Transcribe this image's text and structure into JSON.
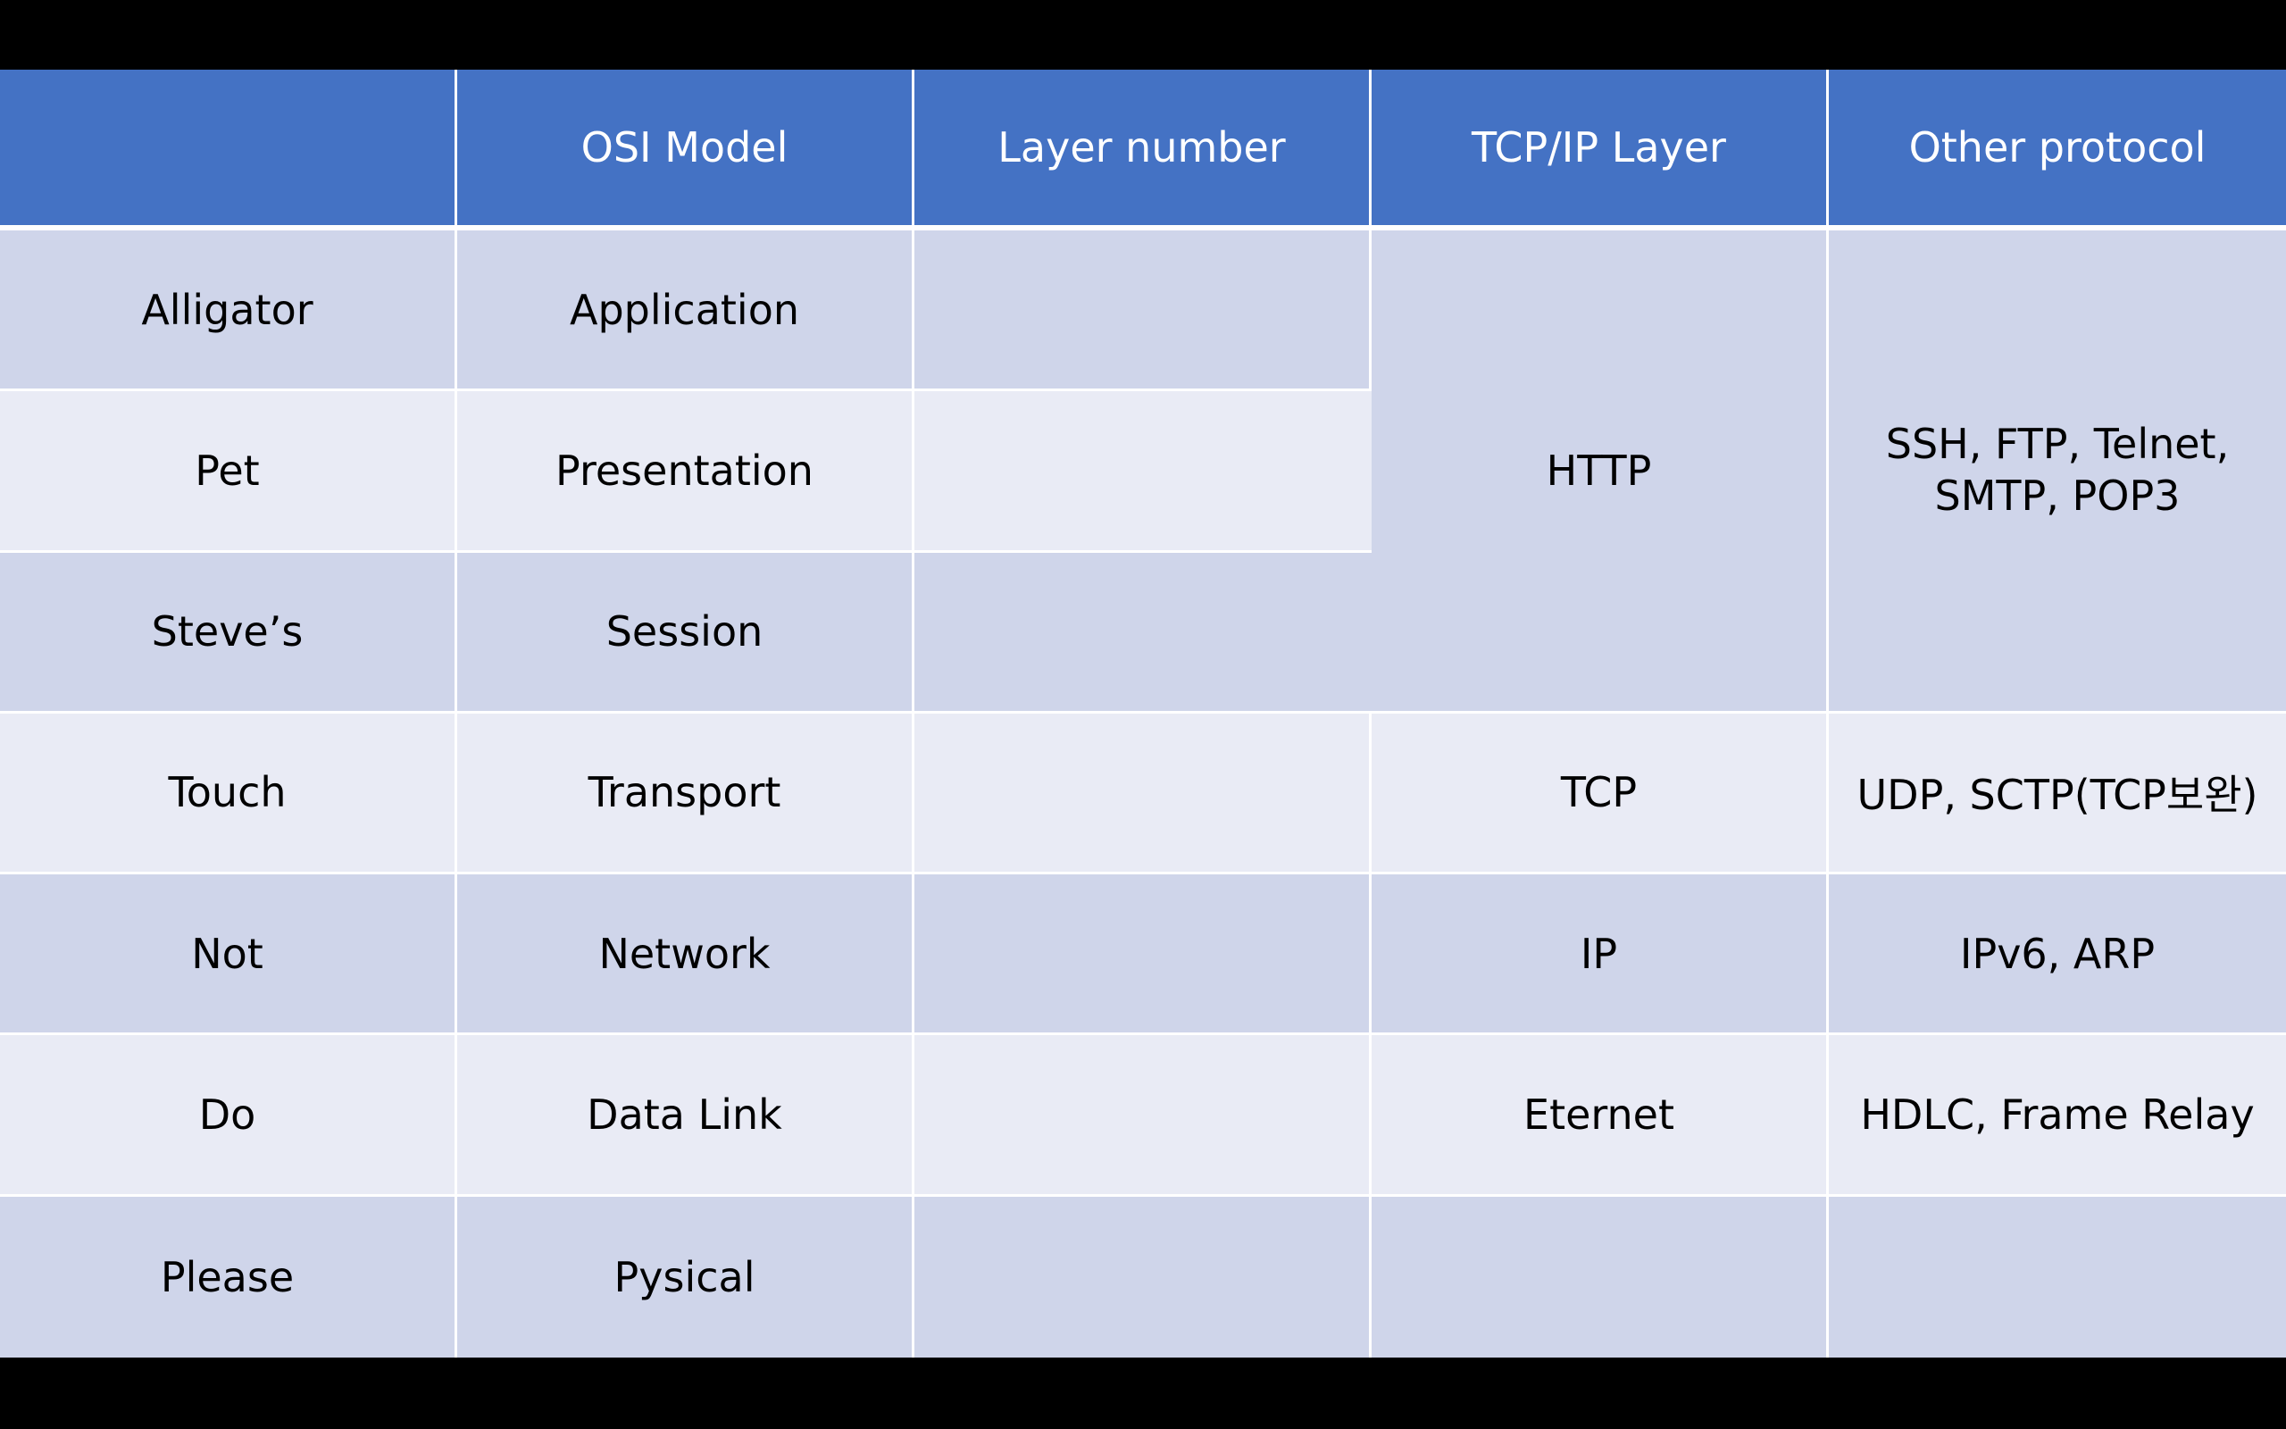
{
  "colors": {
    "header_bg": "#4472c4",
    "header_text": "#ffffff",
    "row_dark": "#cfd5ea",
    "row_light": "#e9ebf5",
    "accent_red": "#ff0000",
    "frame": "#000000"
  },
  "table": {
    "headers": [
      "",
      "OSI Model",
      "Layer number",
      "TCP/IP Layer",
      "Other protocol"
    ],
    "rows": [
      {
        "mnemonic": "Alligator",
        "osi": "Application",
        "layer_number": ""
      },
      {
        "mnemonic": "Pet",
        "osi": "Presentation",
        "layer_number": ""
      },
      {
        "mnemonic": "Steve’s",
        "osi": "Session",
        "layer_number": ""
      },
      {
        "mnemonic": "Touch",
        "osi": "Transport",
        "layer_number": "",
        "tcpip": "TCP",
        "other": "UDP, SCTP(TCP보완)"
      },
      {
        "mnemonic": "Not",
        "osi": "Network",
        "layer_number": "",
        "tcpip": "IP",
        "other": "IPv6, ARP"
      },
      {
        "mnemonic": "Do",
        "osi": "Data Link",
        "layer_number": "",
        "tcpip": "Eternet",
        "other": "HDLC, Frame Relay"
      },
      {
        "mnemonic": "Please",
        "osi": "Pysical",
        "layer_number": "",
        "tcpip": "",
        "other": ""
      }
    ],
    "upper_group": {
      "tcpip": "HTTP",
      "other_line1": "SSH, FTP, Telnet,",
      "other_line2": "SMTP, POP3"
    }
  }
}
